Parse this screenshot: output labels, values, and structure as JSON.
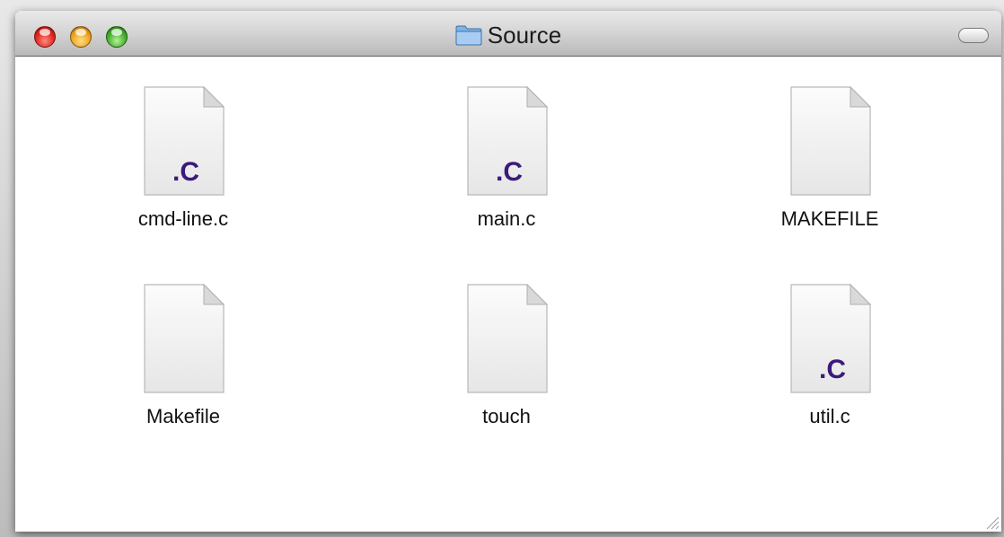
{
  "window": {
    "title": "Source",
    "title_icon": "folder-icon"
  },
  "files": [
    {
      "name": "cmd-line.c",
      "kind": "c-source",
      "badge": ".C"
    },
    {
      "name": "main.c",
      "kind": "c-source",
      "badge": ".C"
    },
    {
      "name": "MAKEFILE",
      "kind": "plain",
      "badge": ""
    },
    {
      "name": "Makefile",
      "kind": "plain",
      "badge": ""
    },
    {
      "name": "touch",
      "kind": "plain",
      "badge": ""
    },
    {
      "name": "util.c",
      "kind": "c-source",
      "badge": ".C"
    }
  ],
  "colors": {
    "close": "#e0241c",
    "minimize": "#f0a21a",
    "zoom": "#3fae28",
    "c_badge": "#3a1a7a"
  }
}
